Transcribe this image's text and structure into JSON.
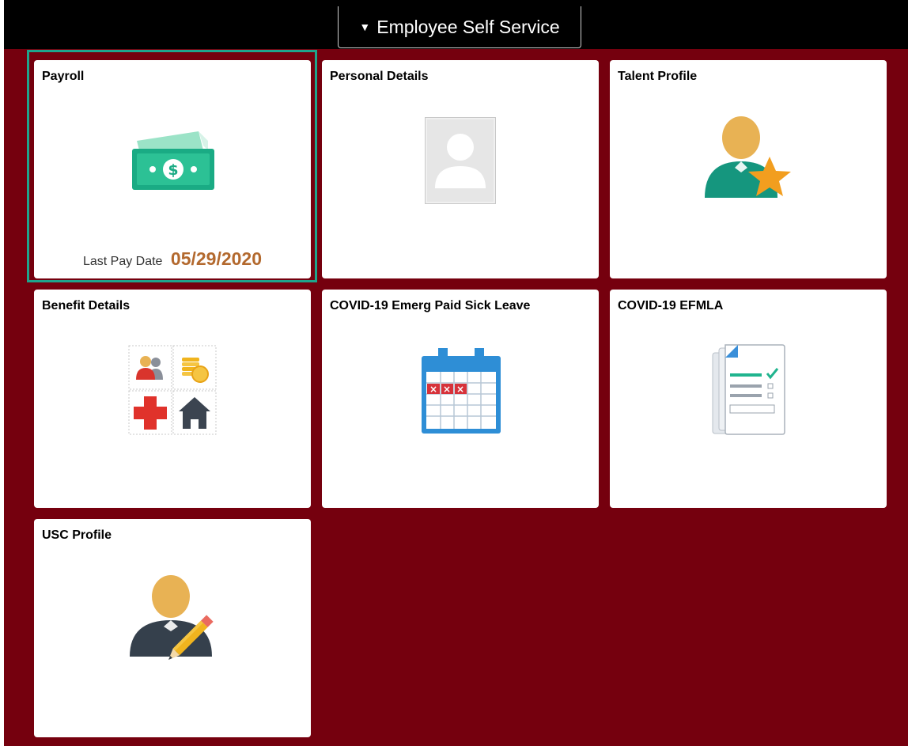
{
  "header": {
    "homepage_selector_label": "Employee Self Service",
    "caret_glyph": "▼"
  },
  "colors": {
    "banner_bg": "#75000e",
    "topbar_bg": "#000000",
    "tile_bg": "#ffffff",
    "focus_ring": "#1fa48c",
    "pay_date": "#b3692e"
  },
  "tiles": [
    {
      "title": "Payroll",
      "icon": "money-bill-icon",
      "footer_label": "Last Pay Date",
      "footer_value": "05/29/2020"
    },
    {
      "title": "Personal Details",
      "icon": "person-photo-placeholder-icon"
    },
    {
      "title": "Talent Profile",
      "icon": "person-star-icon"
    },
    {
      "title": "Benefit Details",
      "icon": "benefits-grid-icon"
    },
    {
      "title": "COVID-19 Emerg Paid Sick Leave",
      "icon": "calendar-icon",
      "icon_glyph": "×"
    },
    {
      "title": "COVID-19 EFMLA",
      "icon": "checklist-document-icon"
    },
    {
      "title": "USC Profile",
      "icon": "person-pencil-icon"
    }
  ]
}
